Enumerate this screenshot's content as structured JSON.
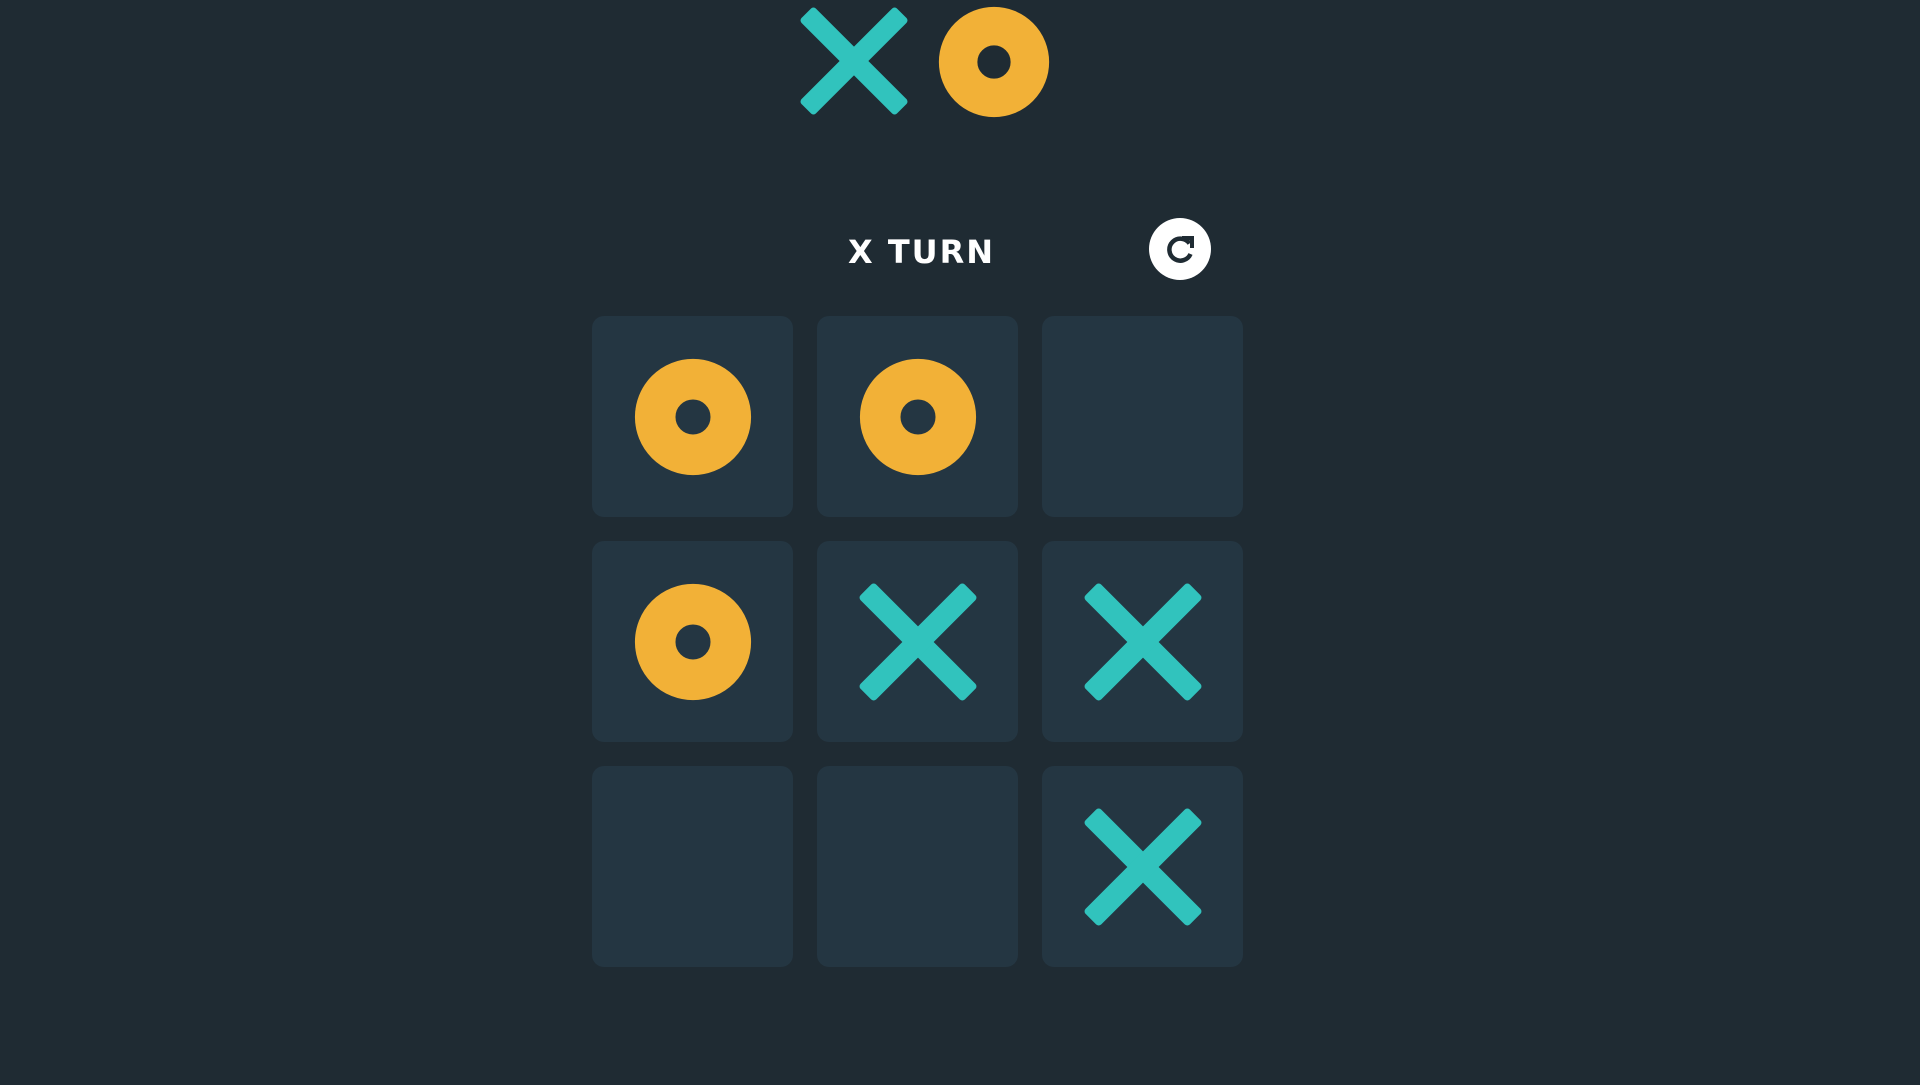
{
  "header": {
    "logo": [
      "x-mark-icon",
      "o-mark-icon"
    ]
  },
  "status": {
    "turn_label": "X TURN",
    "restart_icon": "restart-icon"
  },
  "board": {
    "cells": [
      "O",
      "O",
      "",
      "O",
      "X",
      "X",
      "",
      "",
      "X"
    ]
  },
  "colors": {
    "background": "#1f2b33",
    "cell": "#243642",
    "x_mark": "#31c3bd",
    "o_mark": "#f2b137",
    "text": "#ffffff"
  }
}
